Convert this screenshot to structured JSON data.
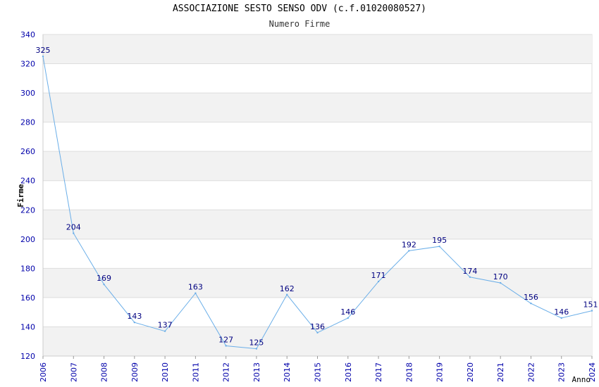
{
  "chart_data": {
    "type": "line",
    "title": "ASSOCIAZIONE SESTO SENSO ODV (c.f.01020080527)",
    "subtitle": "Numero Firme",
    "xlabel": "Anno",
    "ylabel": "Firme",
    "ylim": [
      120,
      340
    ],
    "yticks": [
      120,
      140,
      160,
      180,
      200,
      220,
      240,
      260,
      280,
      300,
      320,
      340
    ],
    "x": [
      "2006",
      "2007",
      "2008",
      "2009",
      "2010",
      "2011",
      "2012",
      "2013",
      "2014",
      "2015",
      "2016",
      "2017",
      "2018",
      "2019",
      "2020",
      "2021",
      "2022",
      "2023",
      "2024"
    ],
    "series": [
      {
        "values": [
          325,
          204,
          169,
          143,
          137,
          163,
          127,
          125,
          162,
          136,
          146,
          171,
          192,
          195,
          174,
          170,
          156,
          146,
          151
        ]
      }
    ],
    "grid": "horizontal alternating bands",
    "colors": {
      "line": "#6aaee8",
      "band": "#f2f2f2",
      "grid": "#dddddd",
      "tick_labels": "#0000aa",
      "data_labels": "#000080"
    }
  }
}
